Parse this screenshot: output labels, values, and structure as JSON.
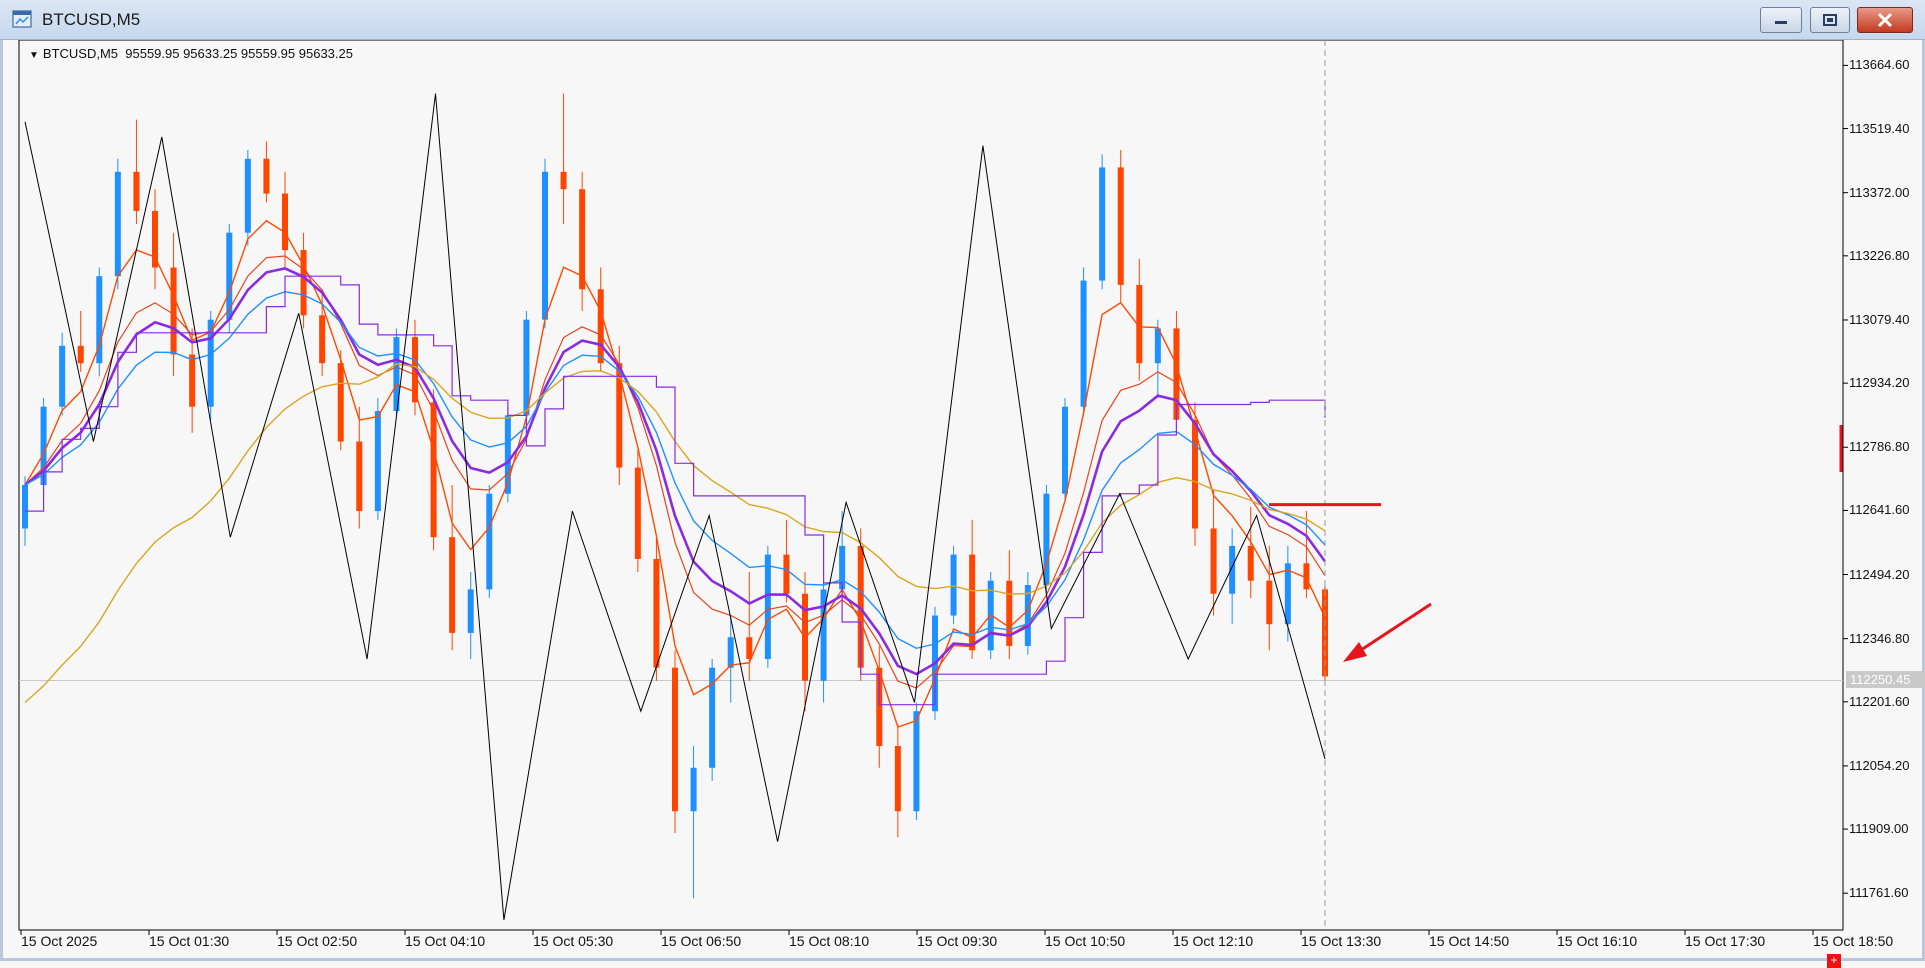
{
  "window": {
    "title": "BTCUSD,M5",
    "controls": {
      "minimize": "minimize-icon",
      "maximize": "maximize-icon",
      "close": "close-icon"
    }
  },
  "chart": {
    "header": "BTCUSD,M5  95559.95 95633.25 95559.95 95633.25",
    "price_axis": [
      "113664.60",
      "113519.40",
      "113372.00",
      "113226.80",
      "113079.40",
      "112934.20",
      "112786.80",
      "112641.60",
      "112494.20",
      "112346.80",
      "112201.60",
      "112054.20",
      "111909.00",
      "111761.60"
    ],
    "current_price": "112250.45",
    "time_axis": [
      "15 Oct 2025",
      "15 Oct 01:30",
      "15 Oct 02:50",
      "15 Oct 04:10",
      "15 Oct 05:30",
      "15 Oct 06:50",
      "15 Oct 08:10",
      "15 Oct 09:30",
      "15 Oct 10:50",
      "15 Oct 12:10",
      "15 Oct 13:30",
      "15 Oct 14:50",
      "15 Oct 16:10",
      "15 Oct 17:30",
      "15 Oct 18:50"
    ],
    "colors": {
      "bull": "#1e90ff",
      "bear": "#ff4500",
      "zigzag": "#000000",
      "ma_fast": "#ff4a00",
      "ma_slow_red": "#e8441c",
      "ma_purple": "#8a2be2",
      "ma_blue": "#1e90ff",
      "ma_gold": "#daa520",
      "step_purple": "#8a2be2",
      "annotation": "#e8141c"
    }
  },
  "chart_data": {
    "type": "candlestick",
    "symbol": "BTCUSD",
    "timeframe": "M5",
    "ylim": [
      111700,
      113700
    ],
    "zigzag_pivots": [
      113535,
      112800,
      113500,
      112580,
      113095,
      112300,
      113600,
      111700,
      112640,
      112180,
      112630,
      111880,
      112660,
      112200,
      113480,
      112370,
      112680,
      112300,
      112630,
      112070
    ],
    "resistance_level": 112655,
    "candles": [
      [
        112600,
        112720,
        112560,
        112700
      ],
      [
        112700,
        112900,
        112680,
        112880
      ],
      [
        112880,
        113050,
        112860,
        113020
      ],
      [
        113020,
        113100,
        112960,
        112980
      ],
      [
        112980,
        113200,
        112950,
        113180
      ],
      [
        113180,
        113450,
        113150,
        113420
      ],
      [
        113420,
        113540,
        113300,
        113330
      ],
      [
        113330,
        113380,
        113150,
        113200
      ],
      [
        113200,
        113280,
        112950,
        113000
      ],
      [
        113000,
        113060,
        112820,
        112880
      ],
      [
        112880,
        113100,
        112850,
        113080
      ],
      [
        113080,
        113300,
        113050,
        113280
      ],
      [
        113280,
        113470,
        113250,
        113450
      ],
      [
        113450,
        113490,
        113350,
        113370
      ],
      [
        113370,
        113420,
        113200,
        113240
      ],
      [
        113240,
        113280,
        113060,
        113090
      ],
      [
        113090,
        113150,
        112950,
        112980
      ],
      [
        112980,
        113010,
        112780,
        112800
      ],
      [
        112800,
        112880,
        112600,
        112640
      ],
      [
        112640,
        112900,
        112620,
        112870
      ],
      [
        112870,
        113060,
        112860,
        113040
      ],
      [
        113040,
        113080,
        112860,
        112890
      ],
      [
        112890,
        112920,
        112550,
        112580
      ],
      [
        112580,
        112700,
        112320,
        112360
      ],
      [
        112360,
        112500,
        112300,
        112460
      ],
      [
        112460,
        112700,
        112440,
        112680
      ],
      [
        112680,
        112880,
        112660,
        112860
      ],
      [
        112860,
        113100,
        112840,
        113080
      ],
      [
        113080,
        113450,
        113060,
        113420
      ],
      [
        113420,
        113600,
        113300,
        113380
      ],
      [
        113380,
        113420,
        113100,
        113150
      ],
      [
        113150,
        113200,
        112960,
        112980
      ],
      [
        112980,
        113020,
        112700,
        112740
      ],
      [
        112740,
        112780,
        112500,
        112530
      ],
      [
        112530,
        112580,
        112250,
        112280
      ],
      [
        112280,
        112320,
        111900,
        111950
      ],
      [
        111950,
        112100,
        111750,
        112050
      ],
      [
        112050,
        112300,
        112020,
        112280
      ],
      [
        112280,
        112400,
        112200,
        112350
      ],
      [
        112350,
        112500,
        112250,
        112300
      ],
      [
        112300,
        112560,
        112280,
        112540
      ],
      [
        112540,
        112620,
        112430,
        112450
      ],
      [
        112450,
        112500,
        112180,
        112250
      ],
      [
        112250,
        112480,
        112200,
        112460
      ],
      [
        112460,
        112640,
        112440,
        112560
      ],
      [
        112560,
        112600,
        112250,
        112280
      ],
      [
        112280,
        112330,
        112050,
        112100
      ],
      [
        112100,
        112150,
        111890,
        111950
      ],
      [
        111950,
        112200,
        111930,
        112180
      ],
      [
        112180,
        112420,
        112160,
        112400
      ],
      [
        112400,
        112560,
        112380,
        112540
      ],
      [
        112540,
        112620,
        112300,
        112320
      ],
      [
        112320,
        112500,
        112300,
        112480
      ],
      [
        112480,
        112550,
        112300,
        112330
      ],
      [
        112330,
        112500,
        112310,
        112470
      ],
      [
        112470,
        112700,
        112450,
        112680
      ],
      [
        112680,
        112900,
        112660,
        112880
      ],
      [
        112880,
        113200,
        112860,
        113170
      ],
      [
        113170,
        113460,
        113150,
        113430
      ],
      [
        113430,
        113470,
        113120,
        113160
      ],
      [
        113160,
        113220,
        112940,
        112980
      ],
      [
        112980,
        113080,
        112900,
        113060
      ],
      [
        113060,
        113100,
        112820,
        112850
      ],
      [
        112850,
        112890,
        112560,
        112600
      ],
      [
        112600,
        112690,
        112400,
        112450
      ],
      [
        112450,
        112600,
        112380,
        112560
      ],
      [
        112560,
        112650,
        112440,
        112480
      ],
      [
        112480,
        112560,
        112320,
        112380
      ],
      [
        112380,
        112560,
        112340,
        112520
      ],
      [
        112520,
        112640,
        112440,
        112460
      ],
      [
        112460,
        112480,
        112240,
        112260
      ]
    ]
  }
}
